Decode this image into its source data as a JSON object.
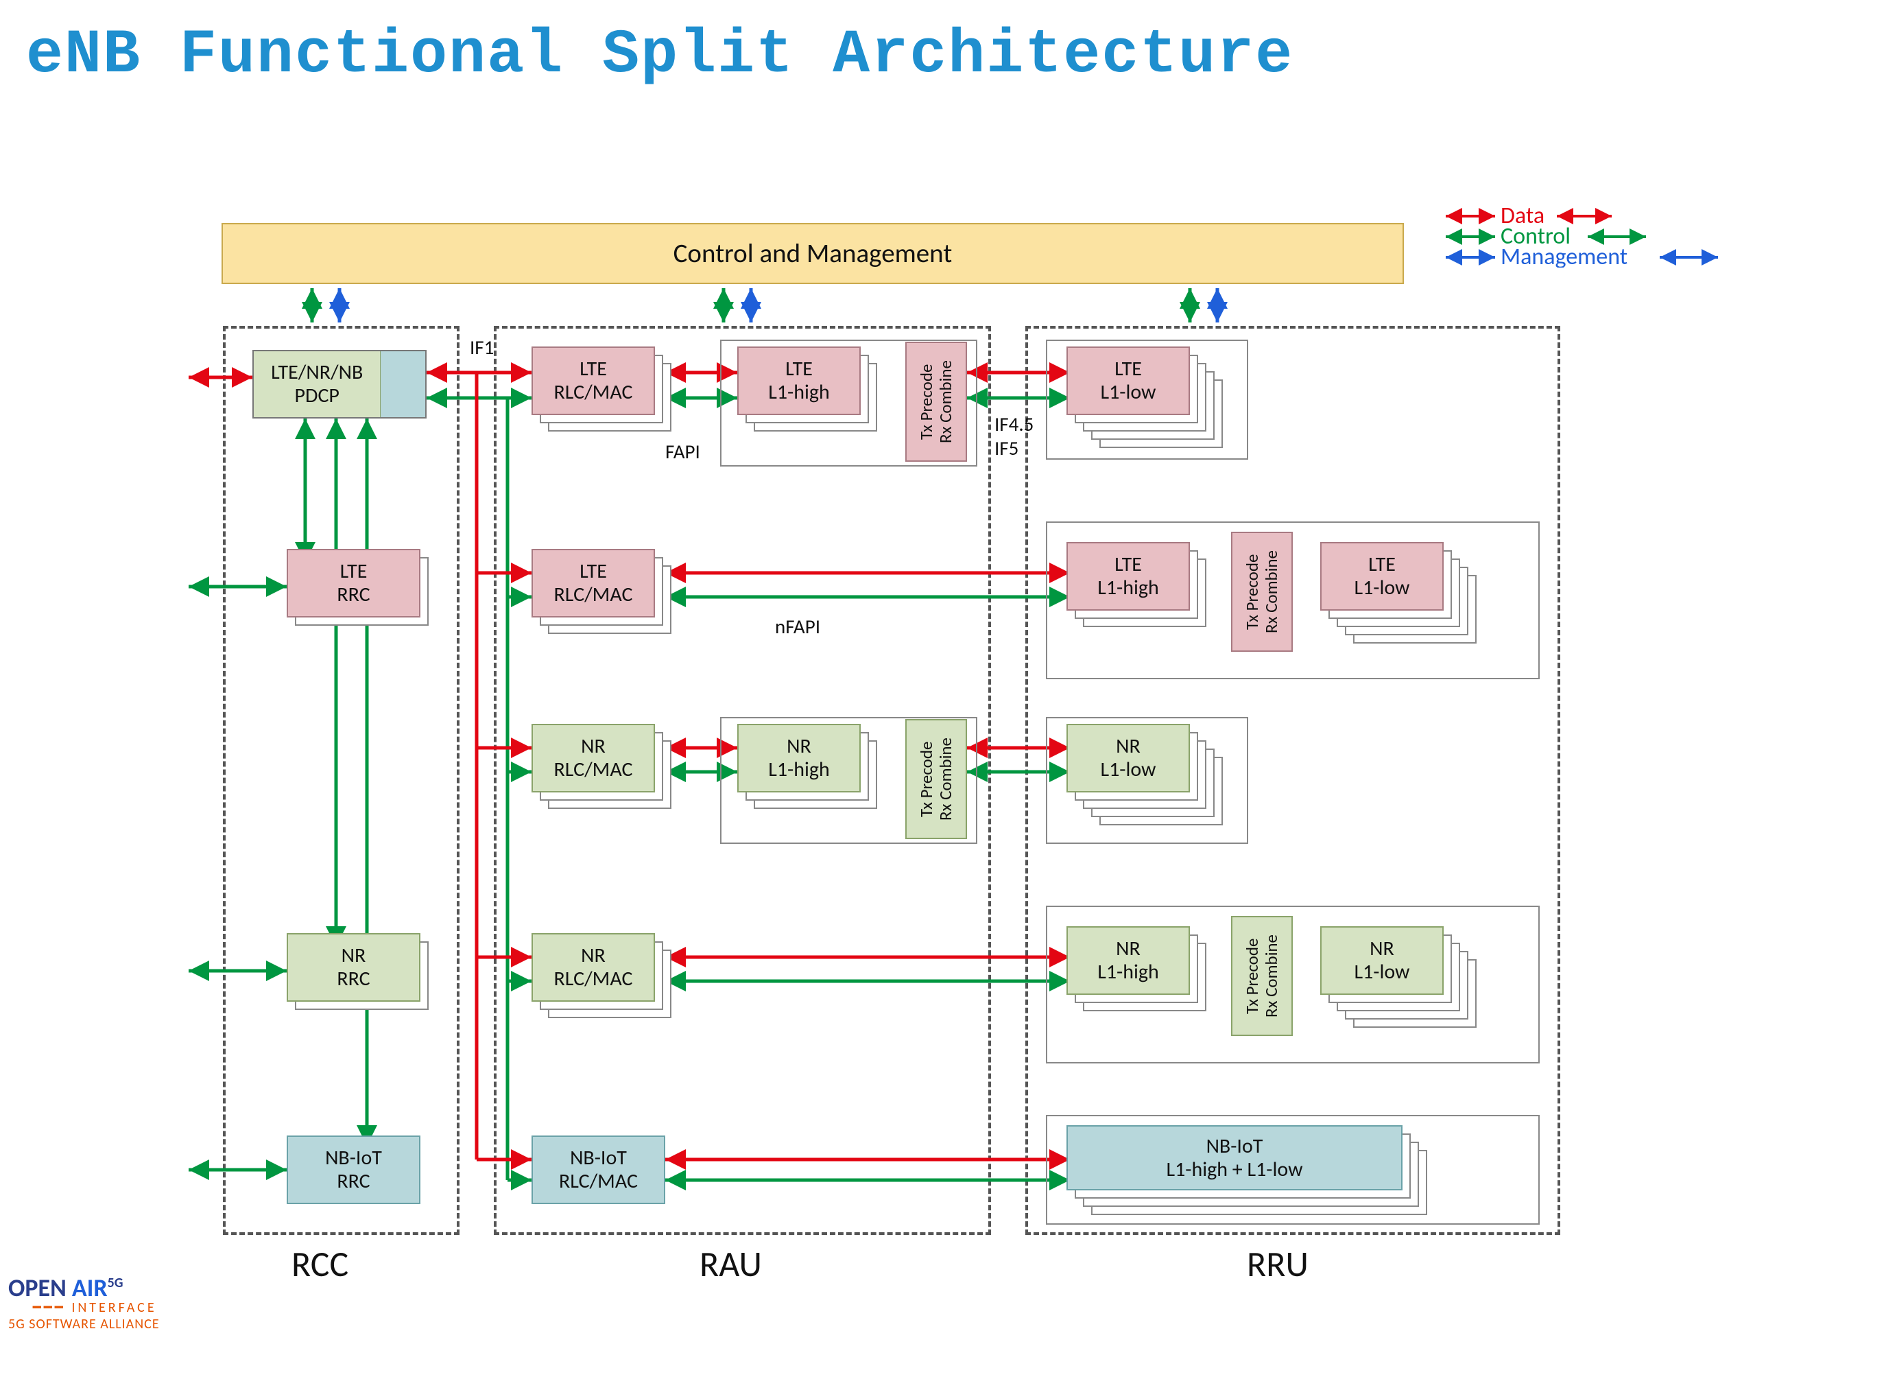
{
  "title": "eNB Functional Split Architecture",
  "controlMgmt": "Control and Management",
  "legend": {
    "data": "Data",
    "control": "Control",
    "management": "Management"
  },
  "zones": {
    "rcc": "RCC",
    "rau": "RAU",
    "rru": "RRU"
  },
  "annotations": {
    "if1": "IF1",
    "fapi": "FAPI",
    "nfapi": "nFAPI",
    "if45": "IF4.5",
    "if5": "IF5"
  },
  "rcc": {
    "pdcp": {
      "l1": "LTE/NR/NB",
      "l2": "PDCP"
    },
    "lteRrc": {
      "l1": "LTE",
      "l2": "RRC"
    },
    "nrRrc": {
      "l1": "NR",
      "l2": "RRC"
    },
    "nbRrc": {
      "l1": "NB-IoT",
      "l2": "RRC"
    }
  },
  "rau": {
    "lteRlc1": {
      "l1": "LTE",
      "l2": "RLC/MAC"
    },
    "lteL1h": {
      "l1": "LTE",
      "l2": "L1-high"
    },
    "lteTxRx": {
      "l1": "Tx Precode",
      "l2": "Rx Combine"
    },
    "lteRlc2": {
      "l1": "LTE",
      "l2": "RLC/MAC"
    },
    "nrRlc1": {
      "l1": "NR",
      "l2": "RLC/MAC"
    },
    "nrL1h": {
      "l1": "NR",
      "l2": "L1-high"
    },
    "nrTxRx": {
      "l1": "Tx Precode",
      "l2": "Rx Combine"
    },
    "nrRlc2": {
      "l1": "NR",
      "l2": "RLC/MAC"
    },
    "nbRlc": {
      "l1": "NB-IoT",
      "l2": "RLC/MAC"
    }
  },
  "rru": {
    "lteL1low1": {
      "l1": "LTE",
      "l2": "L1-low"
    },
    "lteL1h2": {
      "l1": "LTE",
      "l2": "L1-high"
    },
    "lteTxRx2": {
      "l1": "Tx Precode",
      "l2": "Rx Combine"
    },
    "lteL1low2": {
      "l1": "LTE",
      "l2": "L1-low"
    },
    "nrL1low1": {
      "l1": "NR",
      "l2": "L1-low"
    },
    "nrL1h2": {
      "l1": "NR",
      "l2": "L1-high"
    },
    "nrTxRx2": {
      "l1": "Tx Precode",
      "l2": "Rx Combine"
    },
    "nrL1low2": {
      "l1": "NR",
      "l2": "L1-low"
    },
    "nbL1": {
      "l1": "NB-IoT",
      "l2": "L1-high + L1-low"
    }
  },
  "footer": {
    "brand1": "OPEN",
    "brand2": "AIR",
    "brand3": "5G",
    "brand4": "INTERFACE",
    "brand5": "5G SOFTWARE ALLIANCE"
  }
}
